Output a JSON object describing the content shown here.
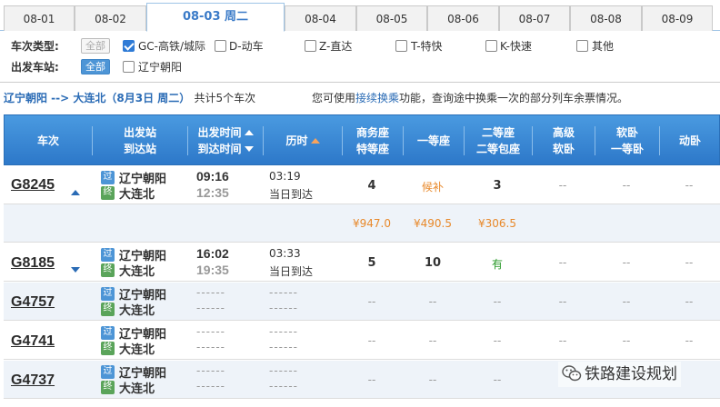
{
  "date_tabs": [
    {
      "label": "08-01"
    },
    {
      "label": "08-02"
    },
    {
      "label": "08-03 周二"
    },
    {
      "label": "08-04"
    },
    {
      "label": "08-05"
    },
    {
      "label": "08-06"
    },
    {
      "label": "08-07"
    },
    {
      "label": "08-08"
    },
    {
      "label": "08-09"
    }
  ],
  "filters": {
    "type_label": "车次类型:",
    "all_label": "全部",
    "types": [
      {
        "label": "GC-高铁/城际",
        "checked": true
      },
      {
        "label": "D-动车",
        "checked": false
      },
      {
        "label": "Z-直达",
        "checked": false
      },
      {
        "label": "T-特快",
        "checked": false
      },
      {
        "label": "K-快速",
        "checked": false
      },
      {
        "label": "其他",
        "checked": false
      }
    ],
    "station_label": "出发车站:",
    "station_all_label": "全部",
    "stations": [
      {
        "label": "辽宁朝阳",
        "checked": false
      }
    ]
  },
  "summary": {
    "route": "辽宁朝阳 --> 大连北（8月3日  周二）",
    "count": "共计5个车次",
    "tip_prefix": "您可使用",
    "tip_link": "接续换乘",
    "tip_suffix": "功能，查询途中换乘一次的部分列车余票情况。"
  },
  "table": {
    "headers": {
      "train": "车次",
      "stations_1": "出发站",
      "stations_2": "到达站",
      "times_1": "出发时间",
      "times_2": "到达时间",
      "duration": "历时",
      "business_1": "商务座",
      "business_2": "特等座",
      "first": "一等座",
      "second_1": "二等座",
      "second_2": "二等包座",
      "soft_1": "高级",
      "soft_2": "软卧",
      "softsleep_1": "软卧",
      "softsleep_2": "一等卧",
      "dongwo": "动卧"
    },
    "rows": [
      {
        "train": "G8245",
        "from_badge": "过",
        "to_badge": "终",
        "from": "辽宁朝阳",
        "to": "大连北",
        "dep": "09:16",
        "arr": "12:35",
        "duration": "03:19",
        "arrive_day": "当日到达",
        "business": "4",
        "first": "候补",
        "second": "3",
        "gaoji": "--",
        "ruanwo": "--",
        "dongwo": "--",
        "prices": {
          "business": "¥947.0",
          "first": "¥490.5",
          "second": "¥306.5"
        }
      },
      {
        "train": "G8185",
        "from_badge": "过",
        "to_badge": "终",
        "from": "辽宁朝阳",
        "to": "大连北",
        "dep": "16:02",
        "arr": "19:35",
        "duration": "03:33",
        "arrive_day": "当日到达",
        "business": "5",
        "first": "10",
        "second": "有",
        "gaoji": "--",
        "ruanwo": "--",
        "dongwo": "--"
      },
      {
        "train": "G4757",
        "from_badge": "过",
        "to_badge": "终",
        "from": "辽宁朝阳",
        "to": "大连北",
        "dep": "------",
        "arr": "------",
        "duration": "------",
        "arrive_day": "------",
        "business": "--",
        "first": "--",
        "second": "--",
        "gaoji": "--",
        "ruanwo": "--",
        "dongwo": "--"
      },
      {
        "train": "G4741",
        "from_badge": "过",
        "to_badge": "终",
        "from": "辽宁朝阳",
        "to": "大连北",
        "dep": "------",
        "arr": "------",
        "duration": "------",
        "arrive_day": "------",
        "business": "--",
        "first": "--",
        "second": "--",
        "gaoji": "--",
        "ruanwo": "--",
        "dongwo": "--"
      },
      {
        "train": "G4737",
        "from_badge": "过",
        "to_badge": "终",
        "from": "辽宁朝阳",
        "to": "大连北",
        "dep": "------",
        "arr": "------",
        "duration": "------",
        "arrive_day": "------",
        "business": "--",
        "first": "--",
        "second": "--",
        "gaoji": "--",
        "ruanwo": "--",
        "dongwo": "--"
      }
    ]
  },
  "watermark": "铁路建设规划",
  "colors": {
    "accent": "#2d78c9",
    "orange": "#e8892b",
    "green": "#2a9a2a"
  }
}
